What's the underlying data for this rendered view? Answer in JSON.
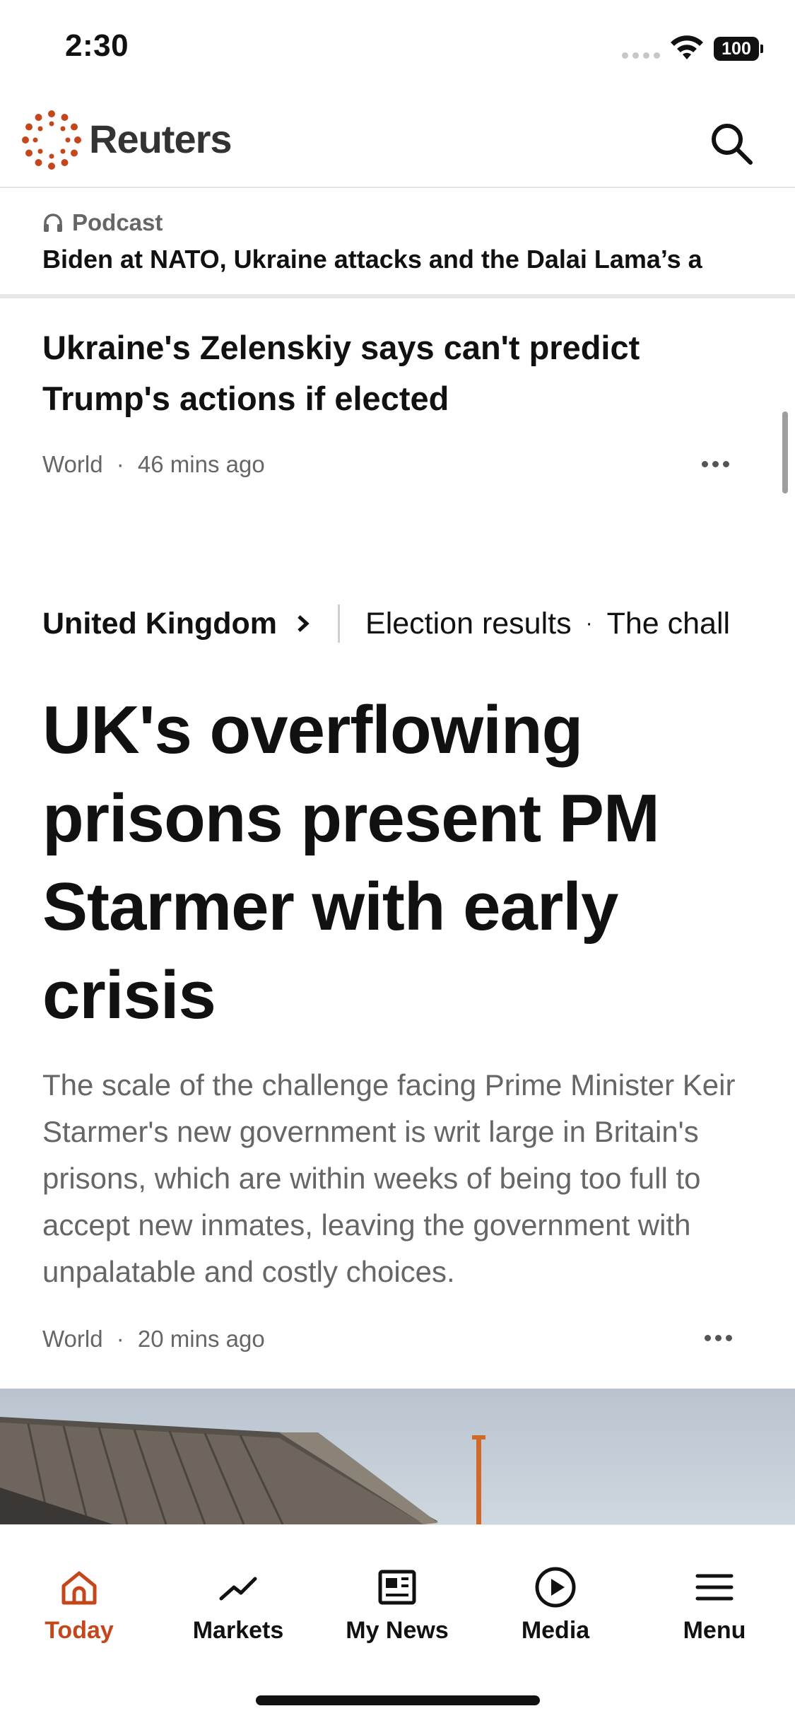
{
  "status_bar": {
    "time": "2:30",
    "battery": "100"
  },
  "header": {
    "brand": "Reuters",
    "brand_color": "#c5461a",
    "search_icon": "search-icon"
  },
  "podcast": {
    "label": "Podcast",
    "title": "Biden at NATO, Ukraine attacks and the Dalai Lama’s a",
    "icon": "headphones-icon"
  },
  "article_1": {
    "title": "Ukraine's Zelenskiy says can't predict Trump's actions if elected",
    "section": "World",
    "time": "46 mins ago"
  },
  "topic_bar": {
    "main": "United Kingdom",
    "links": [
      "Election results",
      "The chall"
    ]
  },
  "main_article": {
    "title": "UK's overflowing prisons present PM Starmer with early crisis",
    "summary": "The scale of the challenge facing Prime Minister Keir Starmer's new government is writ large in Britain's prisons, which are within weeks of being too full to accept new inmates, leaving the government with unpalatable and costly choices.",
    "section": "World",
    "time": "20 mins ago"
  },
  "meta_separator": "·",
  "tabs": [
    {
      "label": "Today",
      "icon": "home-icon",
      "active": true
    },
    {
      "label": "Markets",
      "icon": "trend-line-icon",
      "active": false
    },
    {
      "label": "My News",
      "icon": "news-icon",
      "active": false
    },
    {
      "label": "Media",
      "icon": "play-circle-icon",
      "active": false
    },
    {
      "label": "Menu",
      "icon": "hamburger-icon",
      "active": false
    }
  ],
  "colors": {
    "accent": "#c5461a",
    "text": "#111111",
    "muted": "#666666"
  }
}
